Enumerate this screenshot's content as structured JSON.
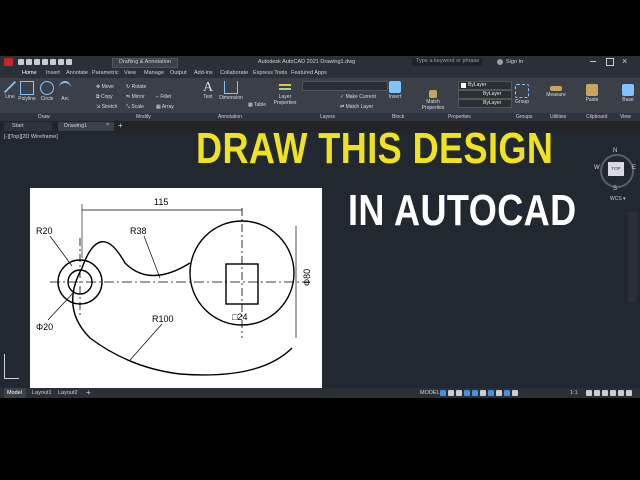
{
  "app": {
    "title": "Autodesk AutoCAD 2021   Drawing1.dwg",
    "workspace": "Drafting & Annotation",
    "search_placeholder": "Type a keyword or phrase",
    "signin": "Sign In"
  },
  "ribbon_tabs": [
    "Home",
    "Insert",
    "Annotate",
    "Parametric",
    "View",
    "Manage",
    "Output",
    "Add-ins",
    "Collaborate",
    "Express Tools",
    "Featured Apps"
  ],
  "tools": {
    "line": "Line",
    "polyline": "Polyline",
    "circle": "Circle",
    "arc": "Arc",
    "move": "Move",
    "rotate": "Rotate",
    "copy": "Copy",
    "mirror": "Mirror",
    "stretch": "Stretch",
    "scale": "Scale",
    "fillet": "Fillet",
    "array": "Array",
    "text": "Text",
    "dimension": "Dimension",
    "table": "Table",
    "layer_properties": "Layer Properties",
    "make_current": "Make Current",
    "match_layer": "Match Layer",
    "insert": "Insert",
    "match_properties": "Match Properties",
    "bylayer1": "ByLayer",
    "bylayer2": "ByLayer",
    "bylayer3": "ByLayer",
    "group": "Group",
    "measure": "Measure",
    "paste": "Paste",
    "base": "Base"
  },
  "panels": [
    "Draw",
    "Modify",
    "Annotation",
    "Layers",
    "Block",
    "Properties",
    "Groups",
    "Utilities",
    "Clipboard",
    "View"
  ],
  "file_tabs": {
    "start": "Start",
    "drawing": "Drawing1"
  },
  "viewport_label": "[-][Top][2D Wireframe]",
  "headline": {
    "line1": "DRAW THIS DESIGN",
    "line2": "IN AUTOCAD"
  },
  "viewcube": {
    "top": "TOP",
    "n": "N",
    "s": "S",
    "e": "E",
    "w": "W",
    "wcs": "WCS"
  },
  "drawing_dims": {
    "width": "115",
    "r20": "R20",
    "r38": "R38",
    "d20": "Φ20",
    "r100": "R100",
    "sq24": "□24",
    "d80": "Φ80"
  },
  "layout_tabs": [
    "Model",
    "Layout1",
    "Layout2"
  ],
  "status": {
    "model": "MODEL",
    "scale": "1:1"
  },
  "colors": {
    "headline_yellow": "#f0e31e",
    "headline_white": "#ffffff",
    "canvas": "#212830",
    "ribbon": "#3a3f48"
  }
}
